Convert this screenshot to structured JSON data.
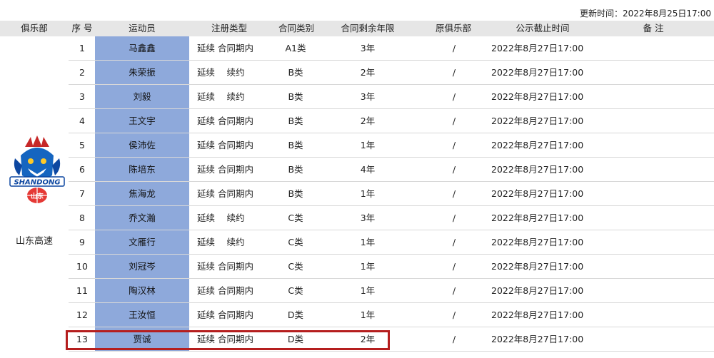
{
  "update_time": "更新时间：2022年8月25日17:00",
  "headers": {
    "club": "俱乐部",
    "seq": "序 号",
    "player": "运动员",
    "reg_type": "注册类型",
    "contract_cat": "合同类别",
    "remaining": "合同剩余年限",
    "orig_club": "原俱乐部",
    "deadline": "公示截止时间",
    "note": "备 注"
  },
  "club": {
    "name": "山东高速",
    "logo_text": "SHANDONG",
    "logo_sub": "山东"
  },
  "rows": [
    {
      "num": "1",
      "name": "马鑫鑫",
      "type": "延续 合同期内",
      "cat": "A1类",
      "yrs": "3年",
      "orig": "/",
      "deadline": "2022年8月27日17:00"
    },
    {
      "num": "2",
      "name": "朱荣振",
      "type": "延续　 续约",
      "cat": "B类",
      "yrs": "2年",
      "orig": "/",
      "deadline": "2022年8月27日17:00"
    },
    {
      "num": "3",
      "name": "刘毅",
      "type": "延续　 续约",
      "cat": "B类",
      "yrs": "3年",
      "orig": "/",
      "deadline": "2022年8月27日17:00"
    },
    {
      "num": "4",
      "name": "王文宇",
      "type": "延续 合同期内",
      "cat": "B类",
      "yrs": "2年",
      "orig": "/",
      "deadline": "2022年8月27日17:00"
    },
    {
      "num": "5",
      "name": "侯沛佐",
      "type": "延续 合同期内",
      "cat": "B类",
      "yrs": "1年",
      "orig": "/",
      "deadline": "2022年8月27日17:00"
    },
    {
      "num": "6",
      "name": "陈培东",
      "type": "延续 合同期内",
      "cat": "B类",
      "yrs": "4年",
      "orig": "/",
      "deadline": "2022年8月27日17:00"
    },
    {
      "num": "7",
      "name": "焦海龙",
      "type": "延续 合同期内",
      "cat": "B类",
      "yrs": "1年",
      "orig": "/",
      "deadline": "2022年8月27日17:00"
    },
    {
      "num": "8",
      "name": "乔文瀚",
      "type": "延续　 续约",
      "cat": "C类",
      "yrs": "3年",
      "orig": "/",
      "deadline": "2022年8月27日17:00"
    },
    {
      "num": "9",
      "name": "文雁行",
      "type": "延续　 续约",
      "cat": "C类",
      "yrs": "1年",
      "orig": "/",
      "deadline": "2022年8月27日17:00"
    },
    {
      "num": "10",
      "name": "刘冠岑",
      "type": "延续 合同期内",
      "cat": "C类",
      "yrs": "1年",
      "orig": "/",
      "deadline": "2022年8月27日17:00"
    },
    {
      "num": "11",
      "name": "陶汉林",
      "type": "延续 合同期内",
      "cat": "C类",
      "yrs": "1年",
      "orig": "/",
      "deadline": "2022年8月27日17:00"
    },
    {
      "num": "12",
      "name": "王汝恒",
      "type": "延续 合同期内",
      "cat": "D类",
      "yrs": "1年",
      "orig": "/",
      "deadline": "2022年8月27日17:00"
    },
    {
      "num": "13",
      "name": "贾诚",
      "type": "延续 合同期内",
      "cat": "D类",
      "yrs": "2年",
      "orig": "/",
      "deadline": "2022年8月27日17:00"
    }
  ],
  "colors": {
    "header_bg": "#e6e6e6",
    "name_bg": "#8ea9db",
    "highlight": "#b51e1e"
  }
}
